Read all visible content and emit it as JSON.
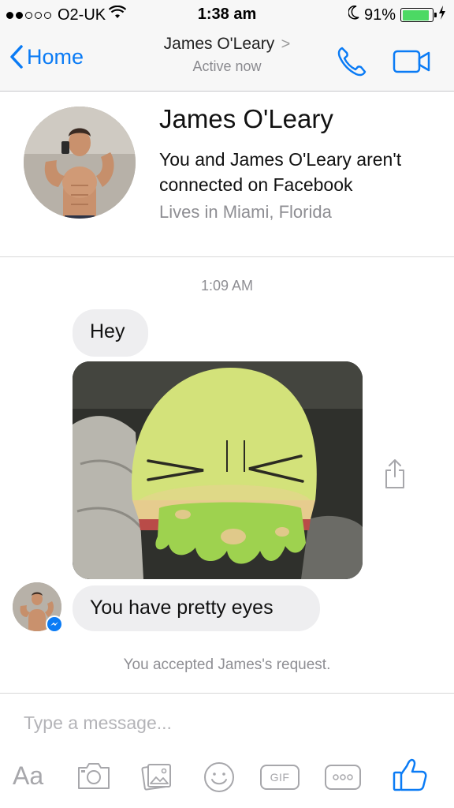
{
  "status_bar": {
    "carrier": "O2-UK",
    "time": "1:38 am",
    "battery_percent": "91%",
    "battery_level": 0.91,
    "signal_bars": 2,
    "signal_total": 5
  },
  "nav": {
    "back_label": "Home",
    "title": "James O'Leary",
    "chevron": ">",
    "subtitle": "Active now",
    "accent_color": "#0a7bf5"
  },
  "profile": {
    "name": "James O'Leary",
    "connection_text": "You and James O'Leary aren't connected on Facebook",
    "location": "Lives in Miami, Florida"
  },
  "chat": {
    "timestamp": "1:09 AM",
    "messages": [
      {
        "type": "text",
        "text": "Hey"
      },
      {
        "type": "image",
        "description": ""
      },
      {
        "type": "text",
        "text": "You have pretty eyes"
      }
    ],
    "system_note": "You accepted James's request."
  },
  "composer": {
    "placeholder": "Type a message...",
    "aa_label": "Aa",
    "gif_label": "GIF",
    "icons": [
      "aa-icon",
      "camera-icon",
      "gallery-icon",
      "emoji-icon",
      "gif-icon",
      "more-icon",
      "like-icon"
    ]
  }
}
